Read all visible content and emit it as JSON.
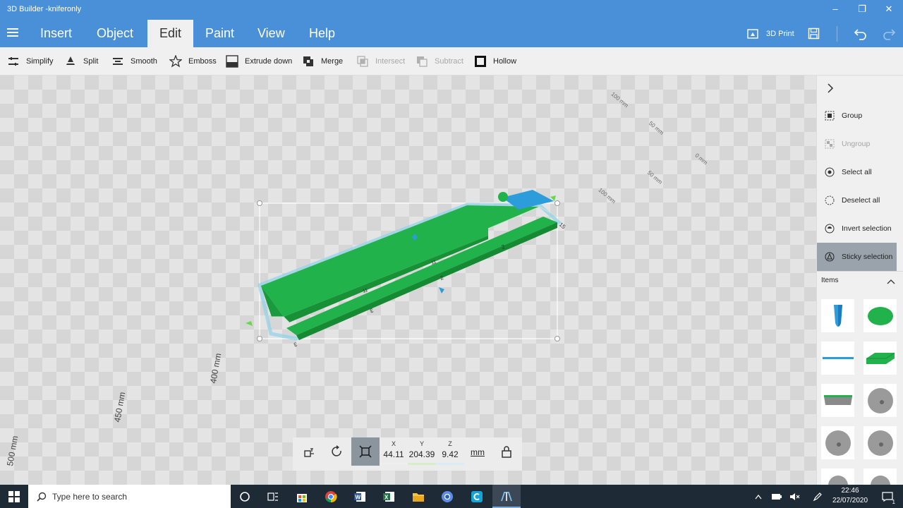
{
  "window": {
    "title": "3D Builder -kniferonly"
  },
  "menu": {
    "tabs": [
      {
        "label": "Insert"
      },
      {
        "label": "Object"
      },
      {
        "label": "Edit"
      },
      {
        "label": "Paint"
      },
      {
        "label": "View"
      },
      {
        "label": "Help"
      }
    ],
    "active_tab": "Edit",
    "print_label": "3D Print"
  },
  "ribbon": {
    "simplify": "Simplify",
    "split": "Split",
    "smooth": "Smooth",
    "emboss": "Emboss",
    "extrude_down": "Extrude down",
    "merge": "Merge",
    "intersect": "Intersect",
    "subtract": "Subtract",
    "hollow": "Hollow"
  },
  "viewport": {
    "rulers": {
      "mm500": "500 mm",
      "mm450": "450 mm",
      "mm400": "400 mm",
      "mm100": "100 mm",
      "mm50a": "50 mm",
      "mm0": "0 mm",
      "mm50b": "50 mm",
      "mm100b": "100 mm"
    },
    "model_color": "#22b24c",
    "accent_color": "#2d9cdb"
  },
  "coords": {
    "x_label": "X",
    "x_value": "44.11",
    "y_label": "Y",
    "y_value": "204.39",
    "z_label": "Z",
    "z_value": "9.42",
    "unit": "mm"
  },
  "panel": {
    "group": "Group",
    "ungroup": "Ungroup",
    "select_all": "Select all",
    "deselect_all": "Deselect all",
    "invert_selection": "Invert selection",
    "sticky_selection": "Sticky selection",
    "items_header": "Items"
  },
  "taskbar": {
    "search_placeholder": "Type here to search",
    "time": "22:46",
    "date": "22/07/2020",
    "notification_count": "1"
  }
}
